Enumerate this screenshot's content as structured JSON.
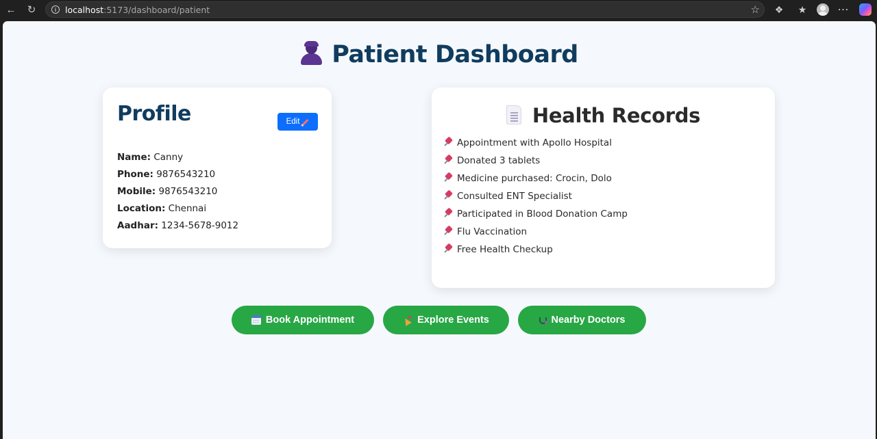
{
  "browser": {
    "url_host": "localhost",
    "url_path": ":5173/dashboard/patient"
  },
  "page": {
    "title": "Patient Dashboard"
  },
  "profile": {
    "heading": "Profile",
    "edit_label": "Edit",
    "fields": [
      {
        "label": "Name:",
        "value": "Canny"
      },
      {
        "label": "Phone:",
        "value": "9876543210"
      },
      {
        "label": "Mobile:",
        "value": "9876543210"
      },
      {
        "label": "Location:",
        "value": "Chennai"
      },
      {
        "label": "Aadhar:",
        "value": "1234-5678-9012"
      }
    ]
  },
  "records": {
    "heading": "Health Records",
    "items": [
      "Appointment with Apollo Hospital",
      "Donated 3 tablets",
      "Medicine purchased: Crocin, Dolo",
      "Consulted ENT Specialist",
      "Participated in Blood Donation Camp",
      "Flu Vaccination",
      "Free Health Checkup"
    ]
  },
  "actions": {
    "book": "Book Appointment",
    "events": "Explore Events",
    "doctors": "Nearby Doctors"
  },
  "colors": {
    "primary_text": "#103c5e",
    "edit_button": "#0d6efd",
    "action_button": "#28a745",
    "page_bg": "#f5f9fd"
  }
}
